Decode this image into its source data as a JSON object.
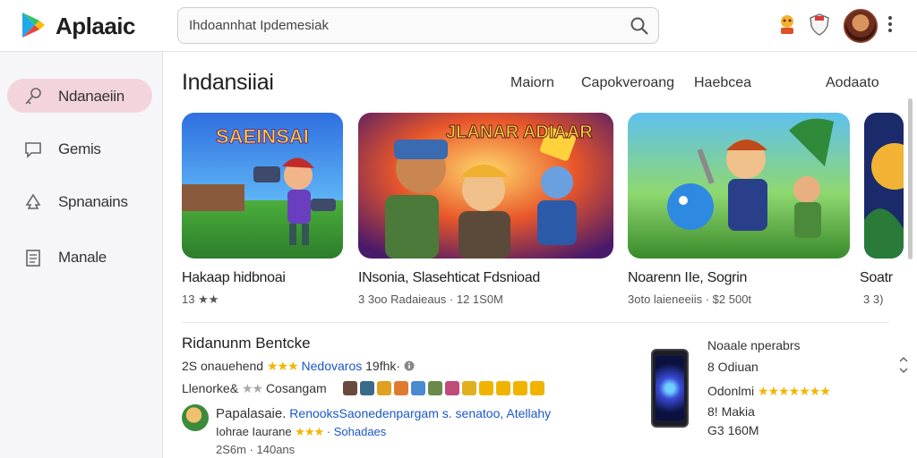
{
  "app": {
    "brand": "Aplaaic"
  },
  "search": {
    "value": "Ihdoannhat Ipdemesiak"
  },
  "sidebar": {
    "items": [
      {
        "label": "Ndanaeiin",
        "icon": "key-icon",
        "active": true
      },
      {
        "label": "Gemis",
        "icon": "chat-icon",
        "active": false
      },
      {
        "label": "Spnanains",
        "icon": "tree-icon",
        "active": false
      },
      {
        "label": "Manale",
        "icon": "document-icon",
        "active": false
      }
    ]
  },
  "main": {
    "title": "Indansiiai",
    "tabs": [
      "Maiorn",
      "Capokveroang",
      "Haebcea",
      "Aodaato"
    ],
    "cards": [
      {
        "art_text": "SAEINSAI",
        "title": "Hakaap hidbnoai",
        "meta": "13 ★★"
      },
      {
        "art_text": "JLANAR ADIAAR",
        "title": "INsonia, Slasehticat Fdsnioad",
        "meta": "3 3oo Radaieaus · 12 1S0M"
      },
      {
        "art_text": "",
        "title": "Noarenn IIe, Sogrin",
        "meta": "3oto laieneeiis · $2 500t"
      },
      {
        "art_text": "",
        "title": "Soatr",
        "meta": "3 3)"
      }
    ]
  },
  "detail": {
    "title": "Ridanunm Bentcke",
    "line1_prefix": "2S onauehend",
    "line1_stars": "★★★",
    "line1_link": "Nedovaros",
    "line1_suffix": "19fhk·",
    "line2_prefix": "Llenorke&",
    "line2_stars": "★★",
    "line2_suffix": "Cosangam",
    "review_name": "Papalasaie.",
    "review_text": "RenooksSaonedenpargam s. senatoo, Atellahy",
    "review_line2_prefix": "Iohrae Iaurane",
    "review_line2_stars": "★★★",
    "review_line2_link": "· Sohadaes",
    "review_line3": "2S6m · 140ans"
  },
  "side_panel": {
    "title": "Noaale nperabrs",
    "line1": "8 Odiuan",
    "line2_prefix": "Odonlmi",
    "line2_stars": "★★★★★★★",
    "line3": "8! Makia",
    "line4": "G3 160M"
  },
  "colors": {
    "accent": "#f3d4dc",
    "star": "#f4b400",
    "link": "#1a57c9"
  }
}
